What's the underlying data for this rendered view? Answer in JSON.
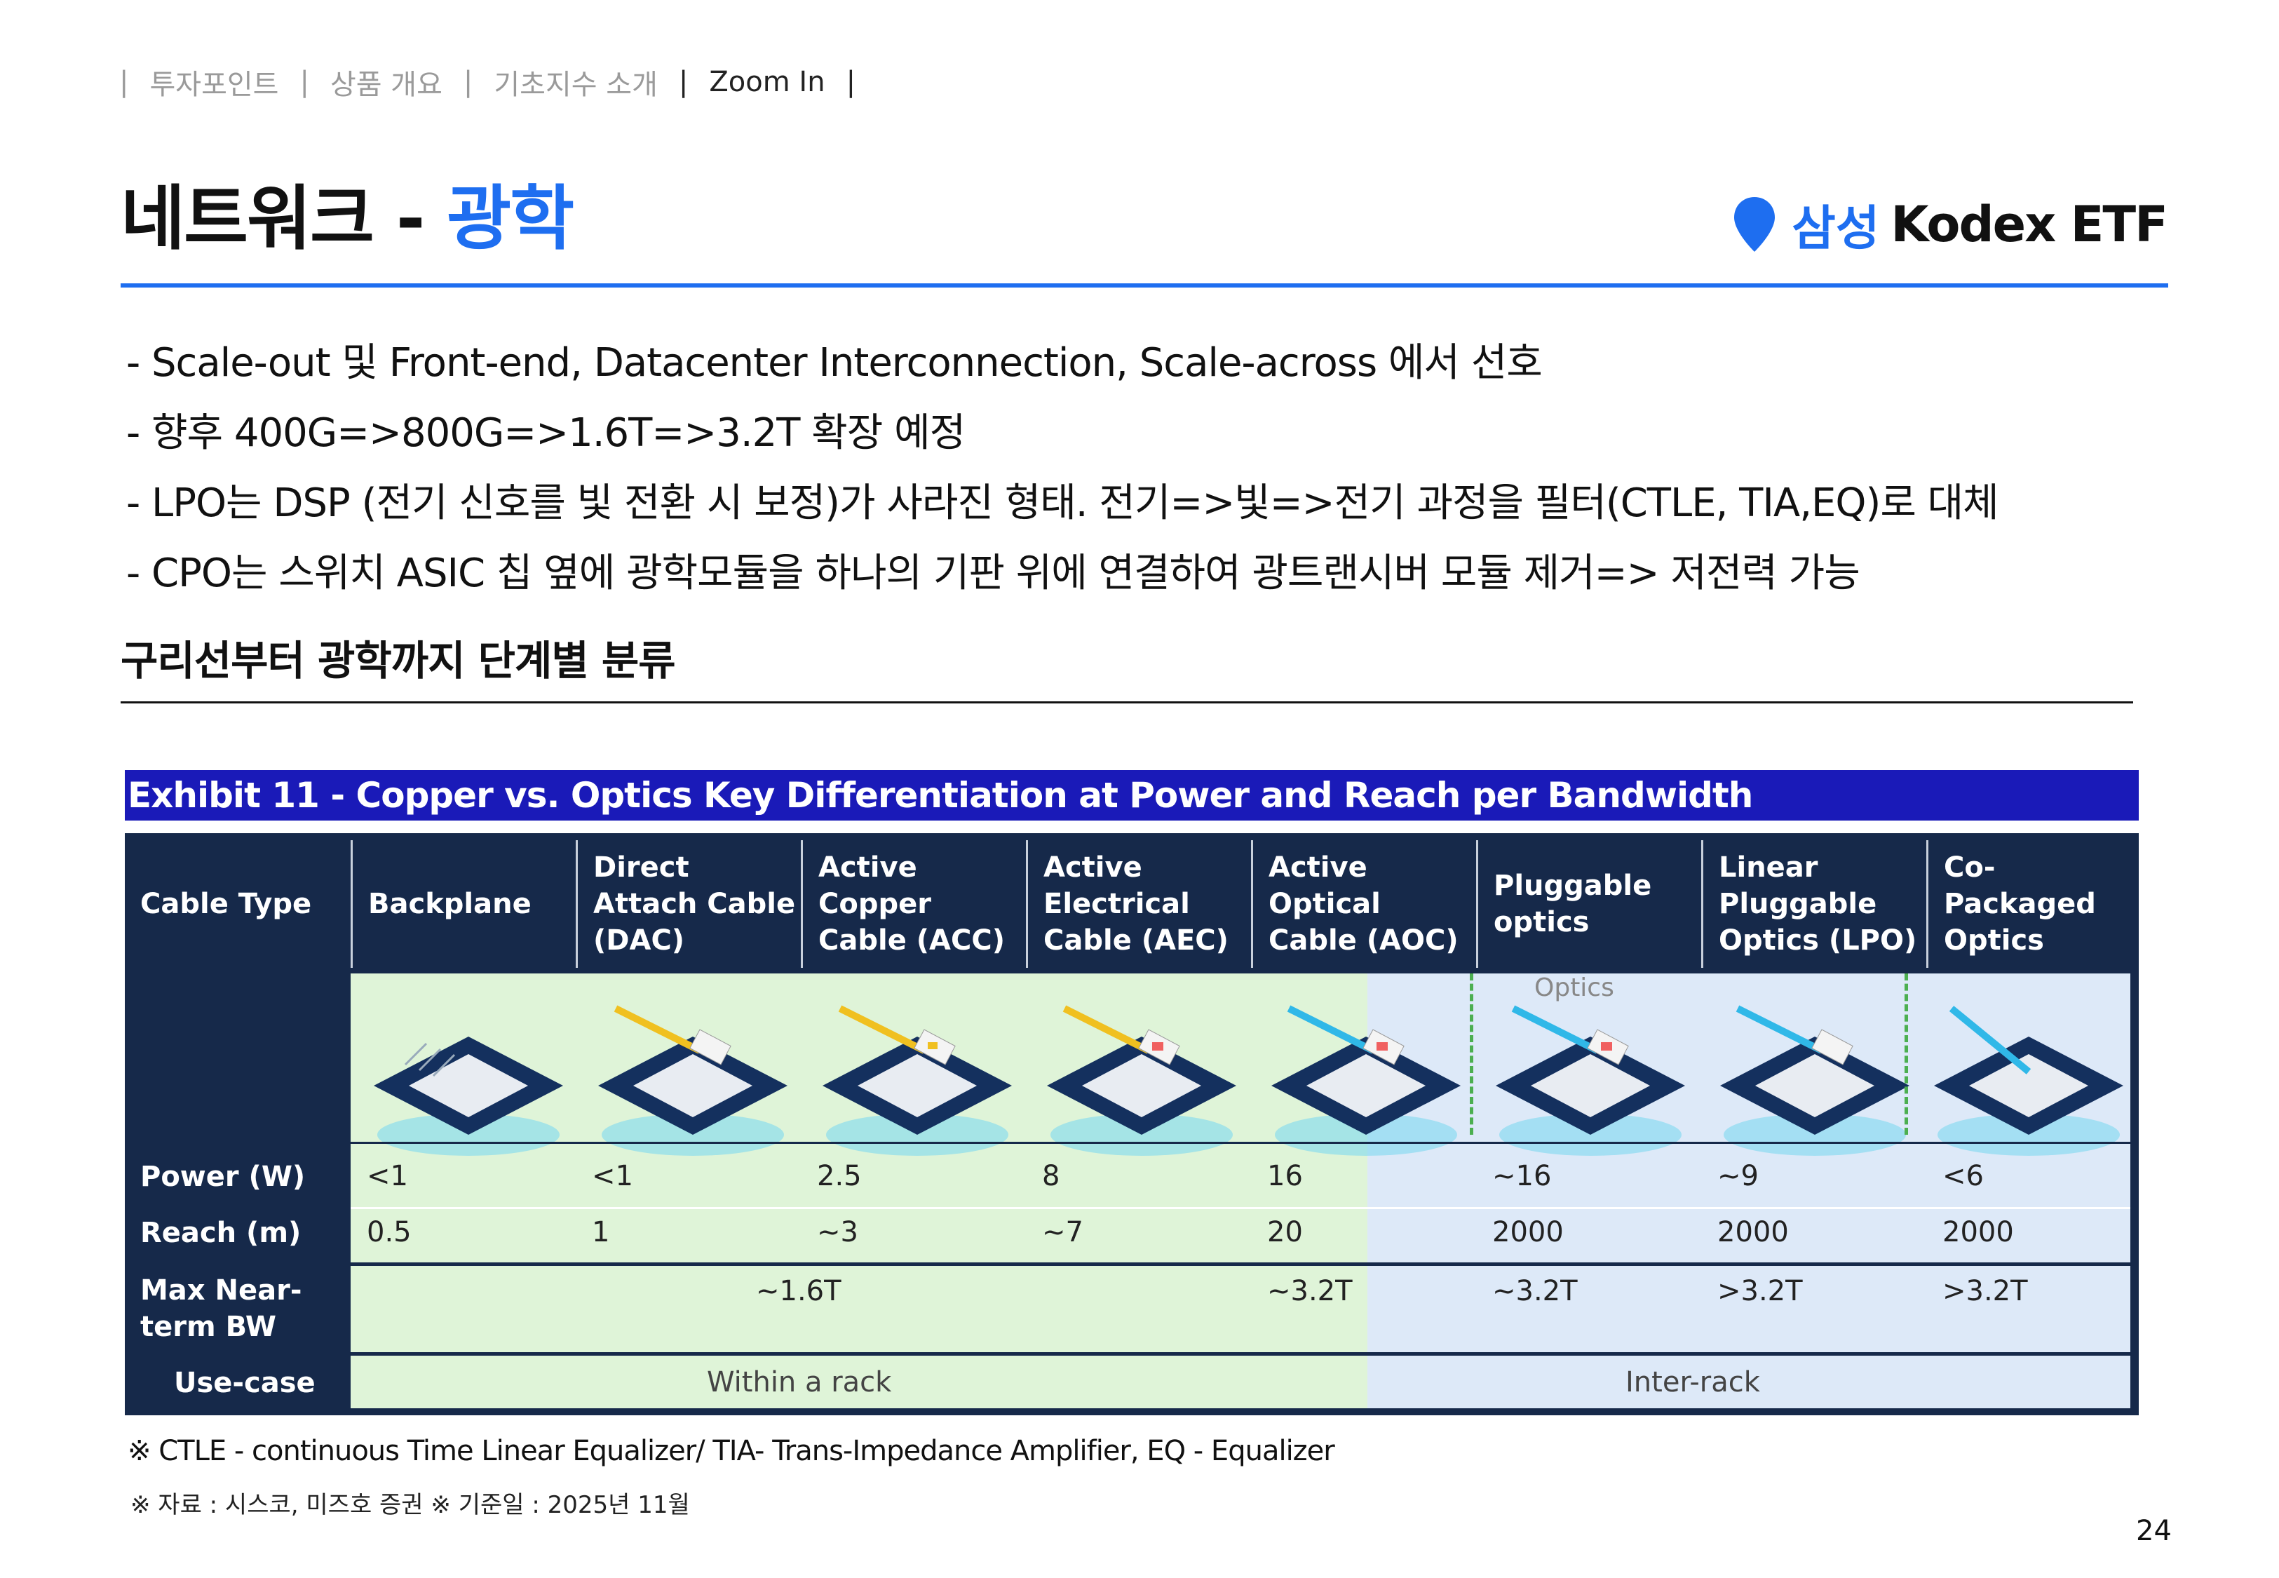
{
  "nav": {
    "items": [
      "투자포인트",
      "상품 개요",
      "기초지수 소개",
      "Zoom In"
    ],
    "separator": "|"
  },
  "header": {
    "title_main": "네트워크 - ",
    "title_accent": "광학",
    "logo_ko": "삼성",
    "logo_en": "Kodex ETF",
    "accent_color": "#1e6ef0"
  },
  "bullets": [
    "- Scale-out 및 Front-end, Datacenter Interconnection, Scale-across 에서 선호",
    "- 향후 400G=>800G=>1.6T=>3.2T 확장 예정",
    "- LPO는 DSP (전기 신호를 빛 전환 시 보정)가 사라진 형태. 전기=>빛=>전기 과정을 필터(CTLE, TIA,EQ)로 대체",
    "- CPO는 스위치 ASIC 칩 옆에 광학모듈을 하나의 기판 위에 연결하여 광트랜시버 모듈 제거=> 저전력 가능"
  ],
  "subhead": "구리선부터 광학까지 단계별 분류",
  "exhibit": {
    "title": "Exhibit 11 - Copper vs. Optics Key Differentiation at Power and Reach per Bandwidth",
    "header_label": "Cable Type",
    "columns": [
      "Backplane",
      "Direct Attach Cable (DAC)",
      "Active Copper Cable (ACC)",
      "Active Electrical Cable (AEC)",
      "Active Optical Cable (AOC)",
      "Pluggable optics",
      "Linear Pluggable Optics (LPO)",
      "Co-Packaged Optics"
    ],
    "optics_label": "Optics",
    "rows": {
      "power_label": "Power (W)",
      "power": [
        "<1",
        "<1",
        "2.5",
        "8",
        "16",
        "~16",
        "~9",
        "<6"
      ],
      "reach_label": "Reach (m)",
      "reach": [
        "0.5",
        "1",
        "~3",
        "~7",
        "20",
        "2000",
        "2000",
        "2000"
      ],
      "bw_label": "Max Near-term BW",
      "bw_copper": "~1.6T",
      "bw_optics": [
        "~3.2T",
        "~3.2T",
        ">3.2T",
        ">3.2T"
      ],
      "usecase_label": "Use-case",
      "usecase_copper": "Within a rack",
      "usecase_optics": "Inter-rack"
    }
  },
  "footnote": "※ CTLE - continuous Time Linear Equalizer/ TIA- Trans-Impedance Amplifier, EQ - Equalizer",
  "source": "※ 자료 : 시스코, 미즈호 증권 ※ 기준일 : 2025년 11월",
  "page_number": "24"
}
